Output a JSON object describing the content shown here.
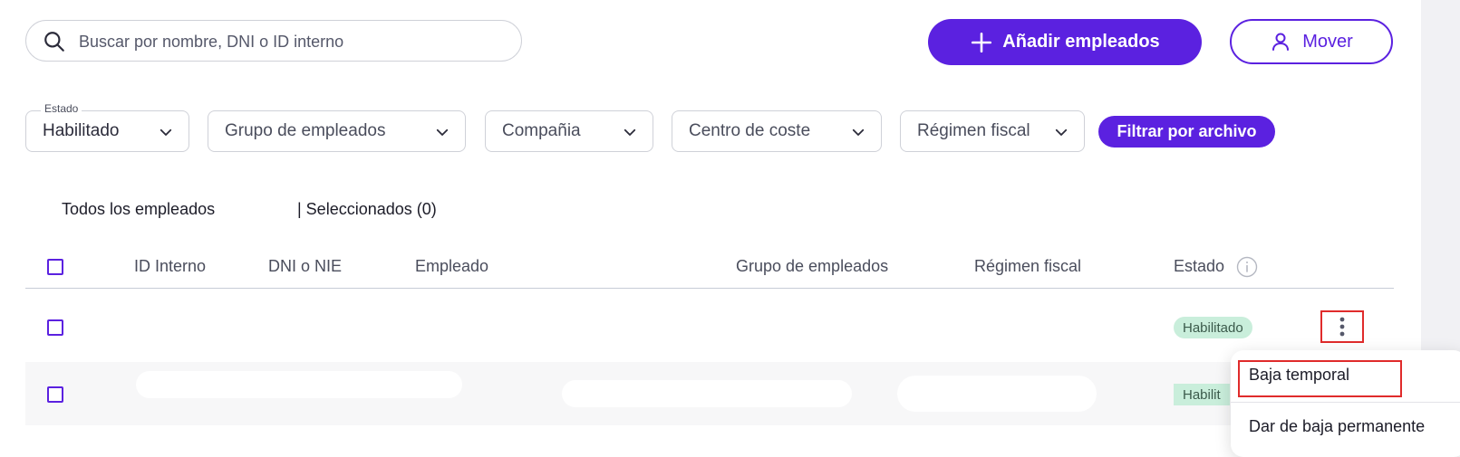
{
  "search": {
    "placeholder": "Buscar por nombre, DNI o ID interno",
    "value": ""
  },
  "actions": {
    "add_label": "Añadir empleados",
    "move_label": "Mover"
  },
  "filters": {
    "estado_label": "Estado",
    "estado_value": "Habilitado",
    "grupo": "Grupo de empleados",
    "compania": "Compañia",
    "centro": "Centro de coste",
    "regimen": "Régimen fiscal",
    "file_button": "Filtrar por archivo"
  },
  "tabs": {
    "all": "Todos los empleados",
    "selected": "| Seleccionados (0)"
  },
  "table": {
    "columns": {
      "id": "ID Interno",
      "dni": "DNI o NIE",
      "employee": "Empleado",
      "group": "Grupo de empleados",
      "regime": "Régimen fiscal",
      "status": "Estado"
    },
    "rows": [
      {
        "status": "Habilitado"
      },
      {
        "status": "Habilit"
      }
    ]
  },
  "row_menu": {
    "items": [
      "Baja temporal",
      "Dar de baja permanente"
    ]
  },
  "colors": {
    "accent": "#5b21e0",
    "badge_bg": "#c9eedb",
    "highlight": "#e02b2b"
  }
}
